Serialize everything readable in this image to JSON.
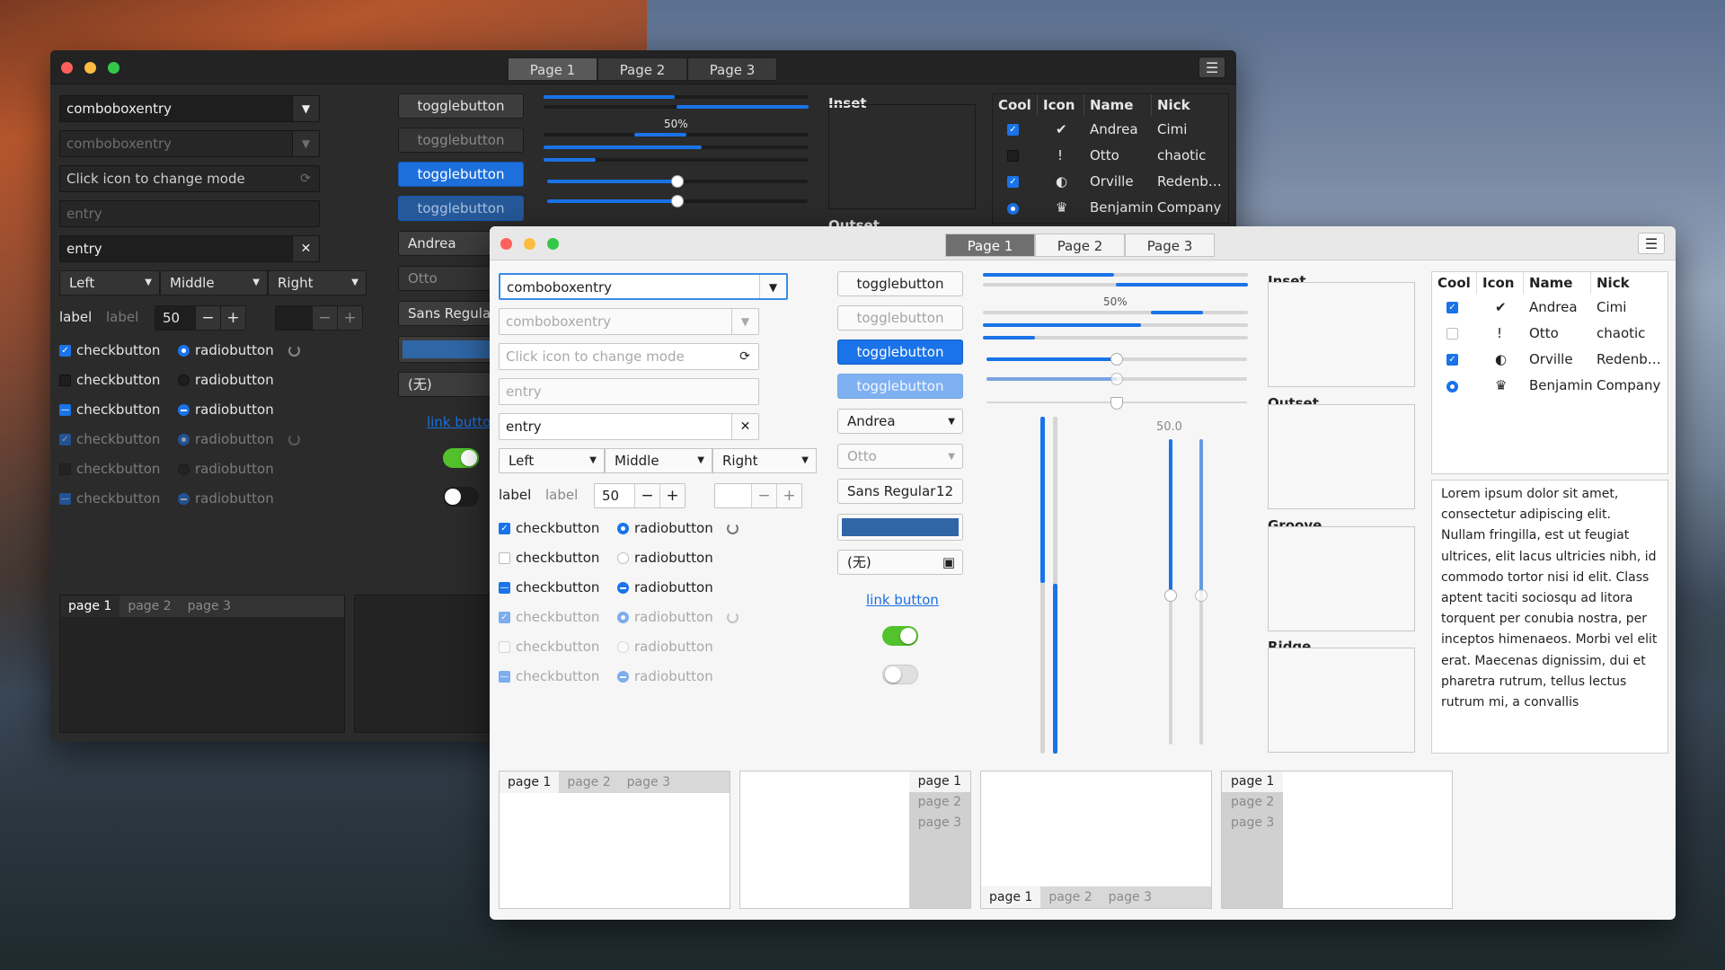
{
  "colors": {
    "accent": "#1a73e8",
    "swatch": "#2f66a6",
    "switch_on": "#53c22c"
  },
  "dark": {
    "tabs": [
      "Page 1",
      "Page 2",
      "Page 3"
    ],
    "menu_icon": "☰",
    "combo1": "comboboxentry",
    "combo2": "comboboxentry",
    "entry_icon_placeholder": "Click icon to change mode",
    "entry_placeholder": "entry",
    "entry_value": "entry",
    "segments": [
      "Left",
      "Middle",
      "Right"
    ],
    "label1": "label",
    "label2": "label",
    "spin_value": "50",
    "minus": "−",
    "plus": "+",
    "check_label": "checkbutton",
    "radio_label": "radiobutton",
    "togglebutton": "togglebutton",
    "combo_andrea": "Andrea",
    "combo_otto": "Otto",
    "font_button": "Sans Regular",
    "file_button": "(无)",
    "link_button": "link button",
    "progress_label": "50%",
    "inset": "Inset",
    "outset": "Outset",
    "tree_headers": [
      "Cool",
      "Icon",
      "Name",
      "Nick"
    ],
    "tree_rows": [
      {
        "name": "Andrea",
        "nick": "Cimi",
        "icon": "✔"
      },
      {
        "name": "Otto",
        "nick": "chaotic",
        "icon": "!"
      },
      {
        "name": "Orville",
        "nick": "Redenb…",
        "icon": "◐"
      },
      {
        "name": "Benjamin",
        "nick": "Company",
        "icon": "♛"
      }
    ],
    "notebook_tabs": [
      "page 1",
      "page 2",
      "page 3"
    ]
  },
  "light": {
    "tabs": [
      "Page 1",
      "Page 2",
      "Page 3"
    ],
    "menu_icon": "☰",
    "combo1": "comboboxentry",
    "combo2": "comboboxentry",
    "entry_icon_placeholder": "Click icon to change mode",
    "entry_placeholder": "entry",
    "entry_value": "entry",
    "segments": [
      "Left",
      "Middle",
      "Right"
    ],
    "label1": "label",
    "label2": "label",
    "spin_value": "50",
    "minus": "−",
    "plus": "+",
    "check_label": "checkbutton",
    "radio_label": "radiobutton",
    "togglebutton": "togglebutton",
    "combo_andrea": "Andrea",
    "combo_otto": "Otto",
    "font_button": "Sans Regular",
    "font_size": "12",
    "file_button": "(无)",
    "link_button": "link button",
    "progress_label": "50%",
    "scale_value": "50.0",
    "progress_fraction": 0.5,
    "inset": "Inset",
    "outset": "Outset",
    "groove": "Groove",
    "ridge": "Ridge",
    "tree_headers": [
      "Cool",
      "Icon",
      "Name",
      "Nick"
    ],
    "tree_rows": [
      {
        "name": "Andrea",
        "nick": "Cimi",
        "icon": "✔"
      },
      {
        "name": "Otto",
        "nick": "chaotic",
        "icon": "!"
      },
      {
        "name": "Orville",
        "nick": "Redenb…",
        "icon": "◐"
      },
      {
        "name": "Benjamin",
        "nick": "Company",
        "icon": "♛"
      }
    ],
    "text_view": "Lorem ipsum dolor sit amet, consectetur adipiscing elit. Nullam fringilla, est ut feugiat ultrices, elit lacus ultricies nibh, id commodo tortor nisi id elit. Class aptent taciti sociosqu ad litora torquent per conubia nostra, per inceptos himenaeos. Morbi vel elit erat. Maecenas dignissim, dui et pharetra rutrum, tellus lectus rutrum mi, a convallis",
    "notebook_tabs": [
      "page 1",
      "page 2",
      "page 3"
    ]
  }
}
